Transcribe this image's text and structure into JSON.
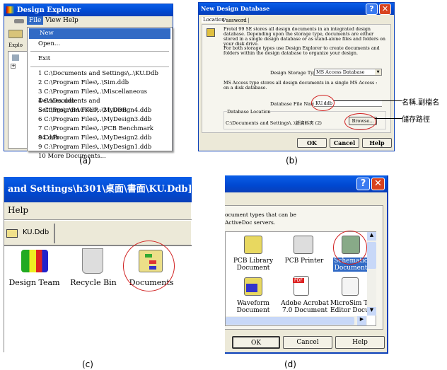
{
  "panel_a": {
    "window_title": "Design Explorer",
    "menu": [
      "File",
      "View",
      "Help"
    ],
    "explorer_tab": "Explo",
    "file_menu": {
      "items": [
        "New",
        "Open...",
        "Exit"
      ],
      "recent": [
        "1 C:\\Documents and Settings\\..\\KU.Ddb",
        "2 C:\\Program Files\\..\\Sim.ddb",
        "3 C:\\Program Files\\..\\Miscellaneous Devices.ddb",
        "4 C:\\Documents and Settings\\..\\BACKUP~21.DDB",
        "5 C:\\Program Files\\..\\MyDesign4.ddb",
        "6 C:\\Program Files\\..\\MyDesign3.ddb",
        "7 C:\\Program Files\\..\\PCB Benchmark 94.ddb",
        "8 C:\\Program Files\\..\\MyDesign2.ddb",
        "9 C:\\Program Files\\..\\MyDesign1.ddb",
        "10 More Documents..."
      ],
      "highlighted": "New"
    },
    "caption": "(a)"
  },
  "panel_b": {
    "window_title": "New Design Database",
    "tabs": [
      "Location",
      "Password"
    ],
    "intro1": "Protel 99 SE stores all design documents in an integrated design database. Depending upon the storage type, documents are either stored in a single design database or as stand-alone files and folders on your disk drive.",
    "intro2": "For both storage types use Design Explorer to create documents and folders within the design database to organize your design.",
    "storage_label": "Design Storage Type",
    "storage_value": "MS Access Database",
    "storage_desc": "MS Access type stores all design documents in a single MS Access : on a disk database.",
    "filename_label": "Database File Name",
    "filename_value": "KU.ddb",
    "location_label": "Database Location",
    "location_value": "C:\\Documents and Settings\\..\\新資料夾 (2)",
    "browse": "Browse...",
    "ok": "OK",
    "cancel": "Cancel",
    "help": "Help",
    "annotation_name": "名稱.副檔名",
    "annotation_path": "儲存路徑",
    "caption": "(b)"
  },
  "panel_c": {
    "title": "and Settings\\h301\\桌面\\書面\\KU.Ddb]",
    "menu": "Help",
    "tab": "KU.Ddb",
    "icons": [
      "Design Team",
      "Recycle Bin",
      "Documents"
    ],
    "caption": "(c)"
  },
  "panel_d": {
    "desc1": "ocument types that can be",
    "desc2": "ActiveDoc servers.",
    "icons": [
      {
        "l1": "PCB Library",
        "l2": "Document"
      },
      {
        "l1": "PCB Printer",
        "l2": ""
      },
      {
        "l1": "Schematic",
        "l2": "Document"
      },
      {
        "l1": "Waveform",
        "l2": "Document"
      },
      {
        "l1": "Adobe Acrobat",
        "l2": "7.0 Document"
      },
      {
        "l1": "MicroSim Tex",
        "l2": "Editor Docu..."
      }
    ],
    "selected": "Schematic Document",
    "pdf_badge": "PDF",
    "ok": "OK",
    "cancel": "Cancel",
    "help": "Help",
    "caption": "(d)"
  }
}
